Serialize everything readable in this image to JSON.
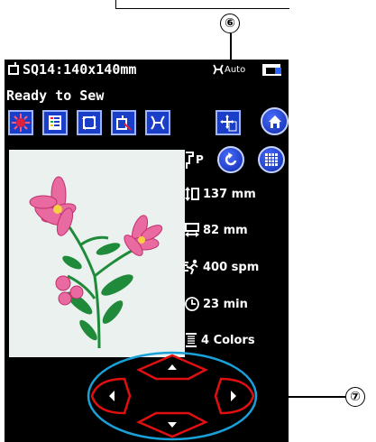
{
  "callouts": {
    "c6": "⑥",
    "c7": "⑦"
  },
  "status": {
    "pattern_label": "SQ14:140x140mm",
    "auto_label": "Auto"
  },
  "ready_text": "Ready to Sew",
  "toolbar_icons": [
    "color-palette-icon",
    "color-list-icon",
    "trace-frame-icon",
    "layout-icon",
    "thread-cutter-icon",
    "jog-position-icon"
  ],
  "stats": {
    "height": "137 mm",
    "width": "82 mm",
    "speed": "400 spm",
    "time": "23 min",
    "colors": "4 Colors"
  },
  "colors": {
    "screen_bg": "#000000",
    "button_blue": "#1a3ec8",
    "pad_red": "#e01010",
    "pad_highlight": "#1aa0d8",
    "flower_pink": "#e86aa0",
    "leaf_green": "#1f8a3a"
  }
}
